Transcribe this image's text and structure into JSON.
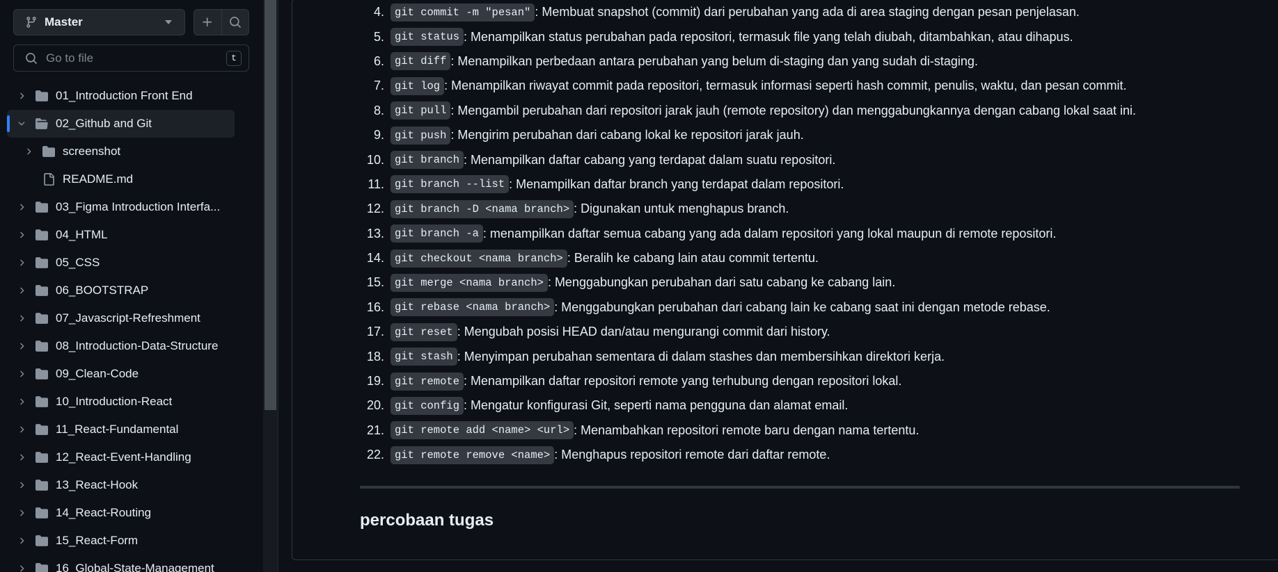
{
  "sidebar": {
    "branch_label": "Master",
    "search_placeholder": "Go to file",
    "search_shortcut": "t",
    "tree": [
      {
        "label": "01_Introduction Front End",
        "type": "folder",
        "indent": 0,
        "expanded": false
      },
      {
        "label": "02_Github and Git",
        "type": "folder",
        "indent": 0,
        "expanded": true,
        "selected": true
      },
      {
        "label": "screenshot",
        "type": "folder",
        "indent": 1,
        "expanded": false
      },
      {
        "label": "README.md",
        "type": "file",
        "indent": 1
      },
      {
        "label": "03_Figma Introduction Interfa...",
        "type": "folder",
        "indent": 0,
        "expanded": false
      },
      {
        "label": "04_HTML",
        "type": "folder",
        "indent": 0,
        "expanded": false
      },
      {
        "label": "05_CSS",
        "type": "folder",
        "indent": 0,
        "expanded": false
      },
      {
        "label": "06_BOOTSTRAP",
        "type": "folder",
        "indent": 0,
        "expanded": false
      },
      {
        "label": "07_Javascript-Refreshment",
        "type": "folder",
        "indent": 0,
        "expanded": false
      },
      {
        "label": "08_Introduction-Data-Structure",
        "type": "folder",
        "indent": 0,
        "expanded": false
      },
      {
        "label": "09_Clean-Code",
        "type": "folder",
        "indent": 0,
        "expanded": false
      },
      {
        "label": "10_Introduction-React",
        "type": "folder",
        "indent": 0,
        "expanded": false
      },
      {
        "label": "11_React-Fundamental",
        "type": "folder",
        "indent": 0,
        "expanded": false
      },
      {
        "label": "12_React-Event-Handling",
        "type": "folder",
        "indent": 0,
        "expanded": false
      },
      {
        "label": "13_React-Hook",
        "type": "folder",
        "indent": 0,
        "expanded": false
      },
      {
        "label": "14_React-Routing",
        "type": "folder",
        "indent": 0,
        "expanded": false
      },
      {
        "label": "15_React-Form",
        "type": "folder",
        "indent": 0,
        "expanded": false
      },
      {
        "label": "16_Global-State-Management",
        "type": "folder",
        "indent": 0,
        "expanded": false
      }
    ]
  },
  "commands": [
    {
      "num": "4.",
      "code": "git commit -m \"pesan\"",
      "desc": ": Membuat snapshot (commit) dari perubahan yang ada di area staging dengan pesan penjelasan."
    },
    {
      "num": "5.",
      "code": "git status",
      "desc": ": Menampilkan status perubahan pada repositori, termasuk file yang telah diubah, ditambahkan, atau dihapus."
    },
    {
      "num": "6.",
      "code": "git diff",
      "desc": ": Menampilkan perbedaan antara perubahan yang belum di-staging dan yang sudah di-staging."
    },
    {
      "num": "7.",
      "code": "git log",
      "desc": ": Menampilkan riwayat commit pada repositori, termasuk informasi seperti hash commit, penulis, waktu, dan pesan commit."
    },
    {
      "num": "8.",
      "code": "git pull",
      "desc": ": Mengambil perubahan dari repositori jarak jauh (remote repository) dan menggabungkannya dengan cabang lokal saat ini."
    },
    {
      "num": "9.",
      "code": "git push",
      "desc": ": Mengirim perubahan dari cabang lokal ke repositori jarak jauh."
    },
    {
      "num": "10.",
      "code": "git branch",
      "desc": ": Menampilkan daftar cabang yang terdapat dalam suatu repositori."
    },
    {
      "num": "11.",
      "code": "git branch --list",
      "desc": " : Menampilkan daftar branch yang terdapat dalam repositori."
    },
    {
      "num": "12.",
      "code": "git branch -D <nama branch>",
      "desc": " : Digunakan untuk menghapus branch."
    },
    {
      "num": "13.",
      "code": "git branch -a",
      "desc": " : menampilkan daftar semua cabang yang ada dalam repositori yang lokal maupun di remote repositori."
    },
    {
      "num": "14.",
      "code": "git checkout <nama branch>",
      "desc": ": Beralih ke cabang lain atau commit tertentu."
    },
    {
      "num": "15.",
      "code": "git merge <nama branch>",
      "desc": ": Menggabungkan perubahan dari satu cabang ke cabang lain."
    },
    {
      "num": "16.",
      "code": "git rebase <nama branch>",
      "desc": ": Menggabungkan perubahan dari cabang lain ke cabang saat ini dengan metode rebase."
    },
    {
      "num": "17.",
      "code": "git reset",
      "desc": ": Mengubah posisi HEAD dan/atau mengurangi commit dari history."
    },
    {
      "num": "18.",
      "code": "git stash",
      "desc": ": Menyimpan perubahan sementara di dalam stashes dan membersihkan direktori kerja."
    },
    {
      "num": "19.",
      "code": "git remote",
      "desc": ": Menampilkan daftar repositori remote yang terhubung dengan repositori lokal."
    },
    {
      "num": "20.",
      "code": "git config",
      "desc": ": Mengatur konfigurasi Git, seperti nama pengguna dan alamat email."
    },
    {
      "num": "21.",
      "code": "git remote add <name> <url>",
      "desc": ": Menambahkan repositori remote baru dengan nama tertentu."
    },
    {
      "num": "22.",
      "code": "git remote remove <name>",
      "desc": ": Menghapus repositori remote dari daftar remote."
    }
  ],
  "section_heading": "percobaan tugas",
  "colors": {
    "accent": "#2f81f7",
    "background": "#0d1117",
    "code_bg": "#343942"
  }
}
